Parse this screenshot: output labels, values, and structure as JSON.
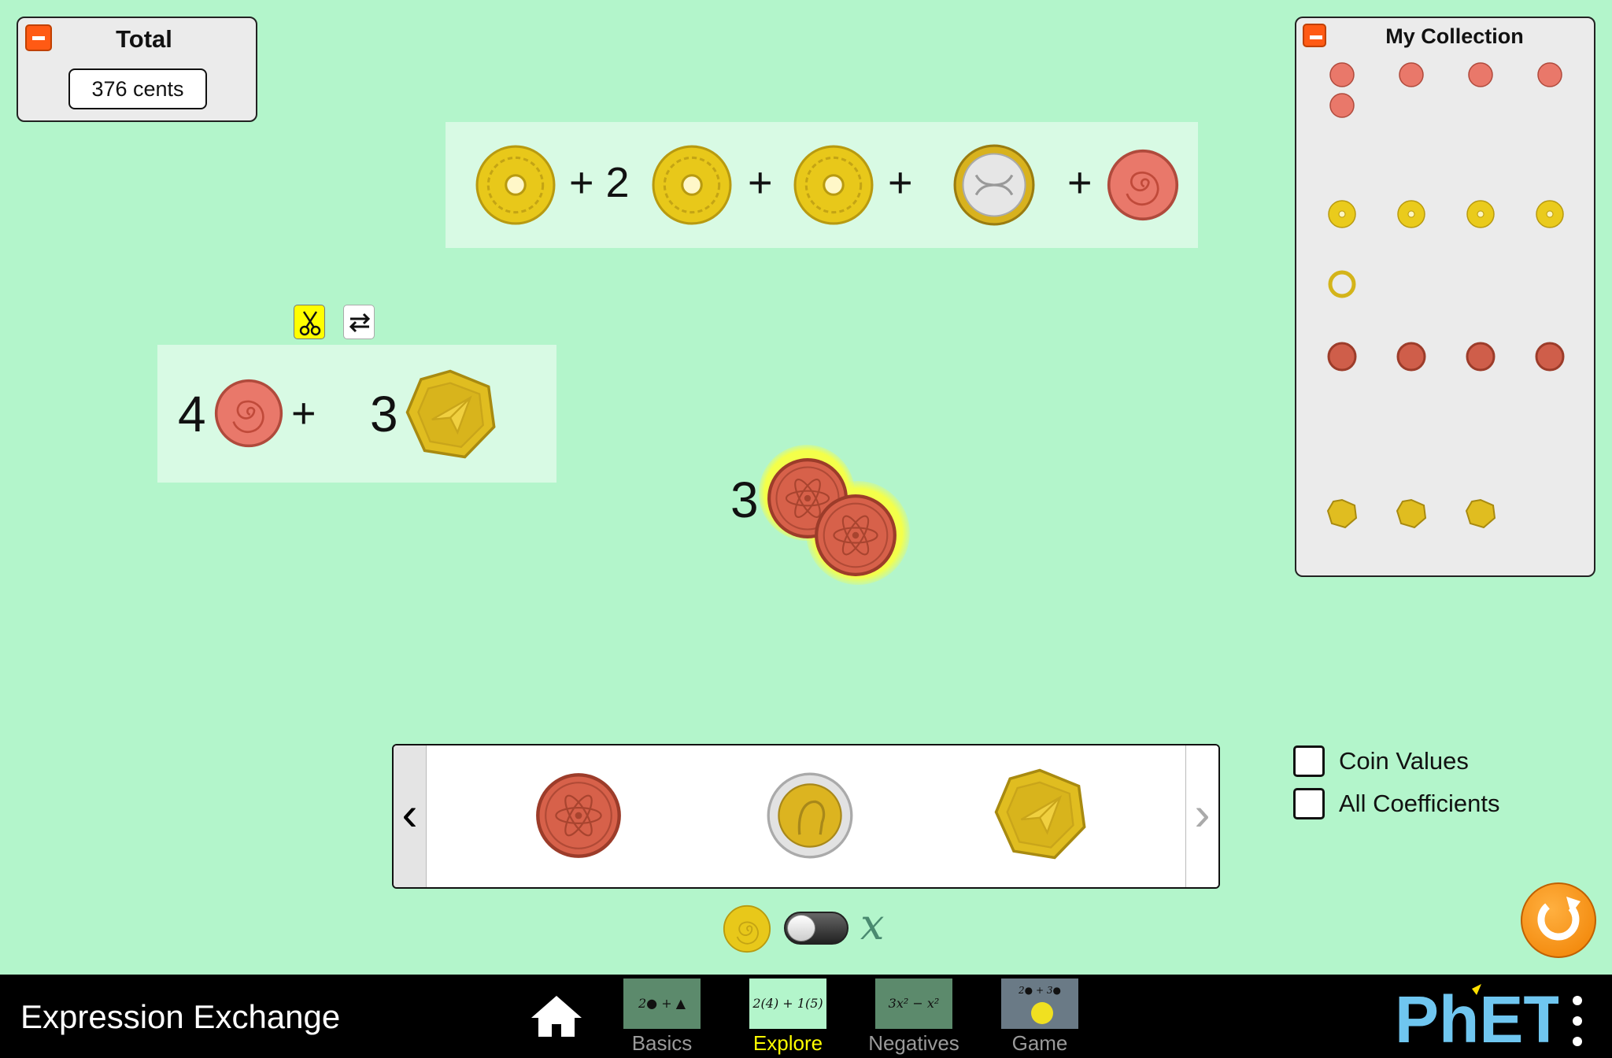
{
  "total_panel": {
    "title": "Total",
    "value": "376 cents"
  },
  "expression_1": {
    "terms": [
      "",
      "+ 2",
      "+",
      "+",
      "+"
    ]
  },
  "expression_2": {
    "coeff_a": "4",
    "plus": "+",
    "coeff_b": "3"
  },
  "floating_coin": {
    "coeff": "3"
  },
  "collection": {
    "title": "My Collection"
  },
  "checkboxes": {
    "coin_values": "Coin Values",
    "all_coefficients": "All Coefficients"
  },
  "variable_toggle": {
    "variable_label": "x"
  },
  "navbar": {
    "app_title": "Expression Exchange",
    "tabs": [
      {
        "label": "Basics",
        "thumb": "2● + ▲"
      },
      {
        "label": "Explore",
        "thumb": "2(4) + 1(5)"
      },
      {
        "label": "Negatives",
        "thumb": "3x² − x²"
      },
      {
        "label": "Game",
        "thumb": "2● + 3●"
      }
    ],
    "brand": "PhET"
  },
  "colors": {
    "background": "#b3f5cb",
    "accent": "#ffff00",
    "reset": "#f08000",
    "panel": "#ebebeb"
  }
}
